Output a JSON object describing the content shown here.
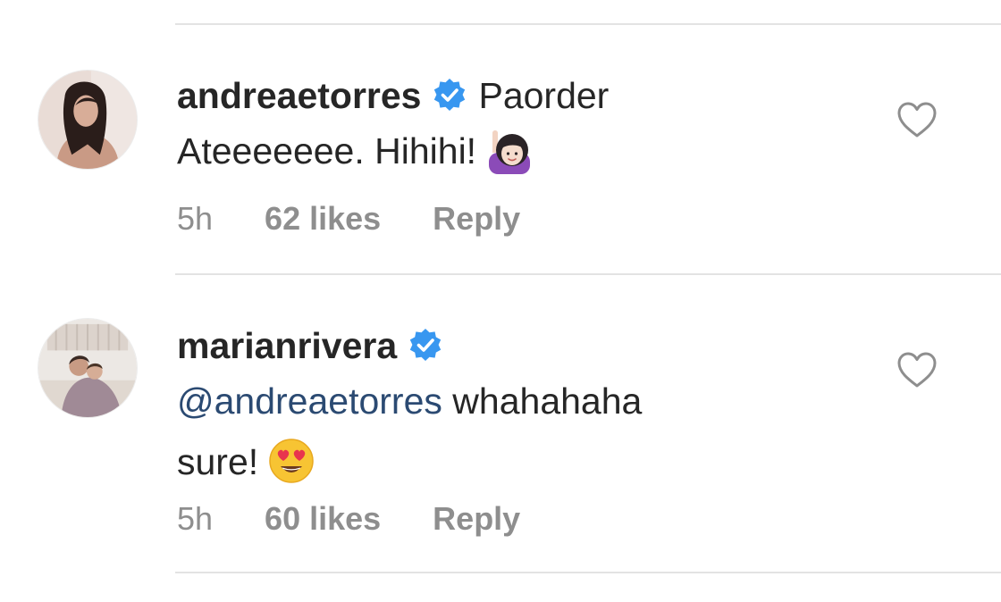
{
  "comments": [
    {
      "username": "andreaetorres",
      "verified": true,
      "text_line1": "Paorder",
      "text_line2": "Ateeeeeee. Hihihi!",
      "emoji": "woman-raising-hand-emoji",
      "time": "5h",
      "likes": "62 likes",
      "reply": "Reply"
    },
    {
      "username": "marianrivera",
      "verified": true,
      "mention": "@andreaetorres",
      "text_line1": "whahahaha",
      "text_line2": "sure!",
      "emoji": "heart-eyes-emoji",
      "time": "5h",
      "likes": "60 likes",
      "reply": "Reply"
    }
  ],
  "colors": {
    "text": "#262626",
    "meta": "#8e8e8e",
    "verified": "#3897f0",
    "mention": "#2b4a72",
    "divider": "#e3e3e3"
  }
}
